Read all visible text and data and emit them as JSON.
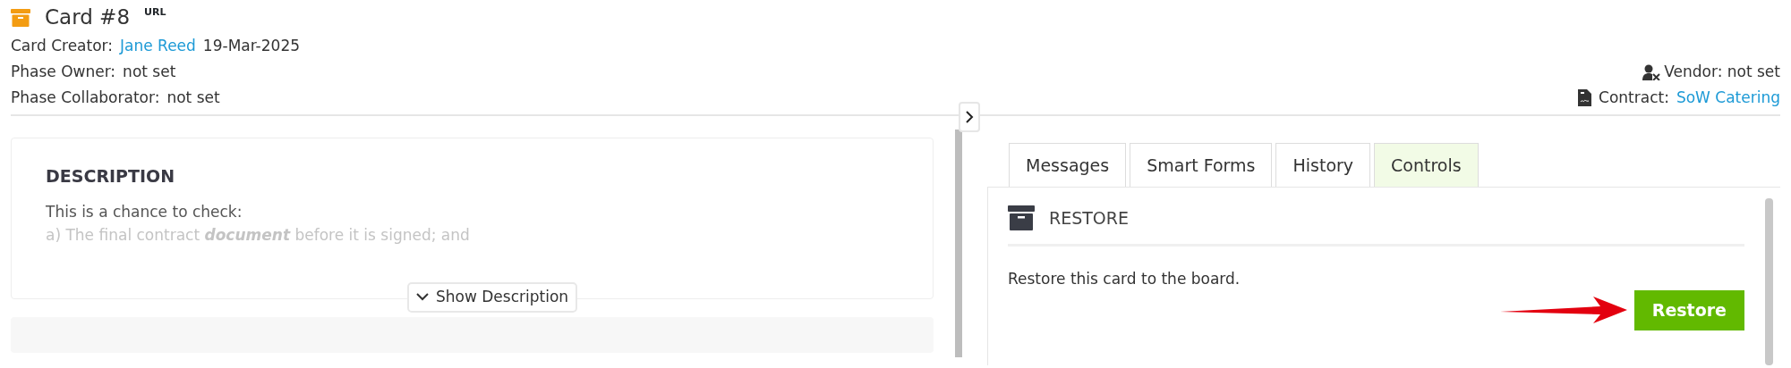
{
  "card": {
    "title": "Card #8",
    "url_label": "URL",
    "creator_label": "Card Creator:",
    "creator": "Jane Reed",
    "created": "19-Mar-2025",
    "owner_label": "Phase Owner:",
    "owner": "not set",
    "collaborator_label": "Phase Collaborator:",
    "collaborator": "not set",
    "vendor": "Vendor: not set",
    "contract_label": "Contract:",
    "contract": "SoW Catering"
  },
  "description": {
    "heading": "DESCRIPTION",
    "lines": [
      "This is a chance to check:",
      "a) The final contract **document** before it is signed; and"
    ],
    "toggle": "Show Description"
  },
  "tabs": [
    {
      "label": "Messages",
      "selected": false
    },
    {
      "label": "Smart Forms",
      "selected": false
    },
    {
      "label": "History",
      "selected": false
    },
    {
      "label": "Controls",
      "selected": true
    }
  ],
  "restore": {
    "heading": "RESTORE",
    "text": "Restore this card to the board.",
    "button": "Restore"
  }
}
